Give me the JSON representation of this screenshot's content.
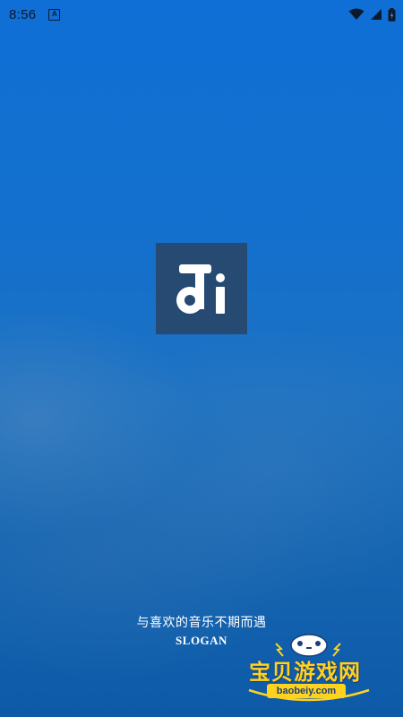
{
  "status_bar": {
    "time": "8:56",
    "notification_icon": "a-letter-icon",
    "icons": [
      "wifi-icon",
      "signal-icon",
      "battery-icon"
    ]
  },
  "splash": {
    "logo_icon": "music-note-logo-icon",
    "logo_text": "Ji",
    "slogan_cn": "与喜欢的音乐不期而遇",
    "slogan_en": "SLOGAN"
  },
  "watermark": {
    "brand": "宝贝游戏网",
    "url": "baobeiy.com",
    "mascot_icon": "gamepad-mascot-icon"
  },
  "colors": {
    "bg_top": "#0f6fd6",
    "bg_bottom": "#0d5aa8",
    "logo_bg": "#264a72",
    "watermark_yellow": "#ffd21e"
  }
}
